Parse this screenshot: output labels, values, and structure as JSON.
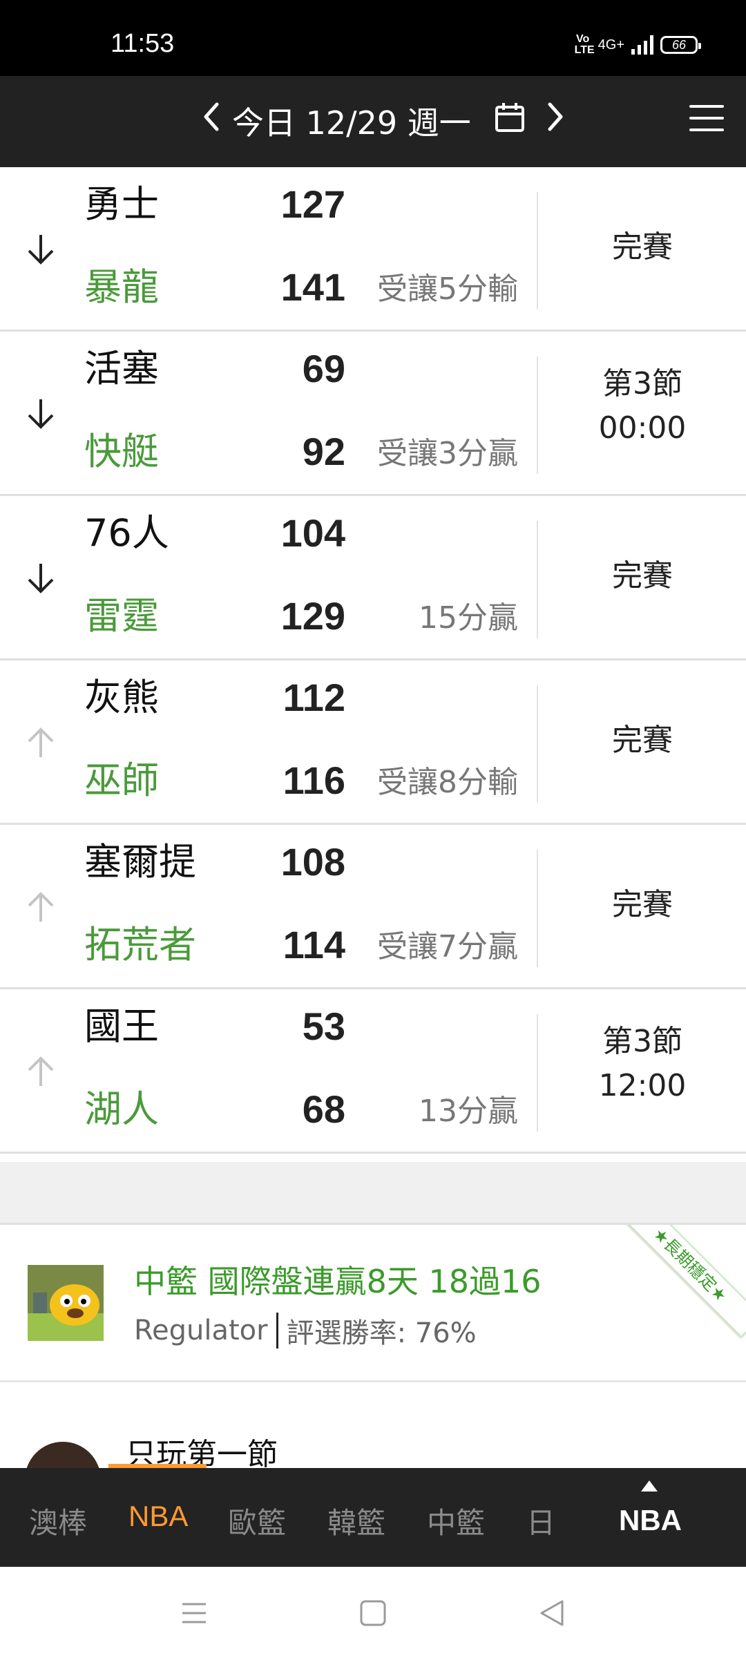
{
  "status_bar": {
    "time": "11:53",
    "network": "4G+",
    "volte": "Vo LTE",
    "battery": "66"
  },
  "header": {
    "date_label": "今日 12/29 週一",
    "prev_icon": "chevron-left-icon",
    "next_icon": "chevron-right-icon",
    "calendar_icon": "calendar-icon",
    "menu_icon": "hamburger-menu-icon"
  },
  "games": [
    {
      "away_team": "勇士",
      "away_score": "127",
      "home_team": "暴龍",
      "home_score": "141",
      "result": "受讓5分輸",
      "status_line1": "完賽",
      "status_line2": "",
      "arrow": "down",
      "arrow_color": "#222222"
    },
    {
      "away_team": "活塞",
      "away_score": "69",
      "home_team": "快艇",
      "home_score": "92",
      "result": "受讓3分贏",
      "status_line1": "第3節",
      "status_line2": "00:00",
      "arrow": "down",
      "arrow_color": "#222222"
    },
    {
      "away_team": "76人",
      "away_score": "104",
      "home_team": "雷霆",
      "home_score": "129",
      "result": "15分贏",
      "status_line1": "完賽",
      "status_line2": "",
      "arrow": "down",
      "arrow_color": "#222222"
    },
    {
      "away_team": "灰熊",
      "away_score": "112",
      "home_team": "巫師",
      "home_score": "116",
      "result": "受讓8分輸",
      "status_line1": "完賽",
      "status_line2": "",
      "arrow": "up",
      "arrow_color": "#c4c4c4"
    },
    {
      "away_team": "塞爾提",
      "away_score": "108",
      "home_team": "拓荒者",
      "home_score": "114",
      "result": "受讓7分贏",
      "status_line1": "完賽",
      "status_line2": "",
      "arrow": "up",
      "arrow_color": "#c4c4c4"
    },
    {
      "away_team": "國王",
      "away_score": "53",
      "home_team": "湖人",
      "home_score": "68",
      "result": "13分贏",
      "status_line1": "第3節",
      "status_line2": "12:00",
      "arrow": "up",
      "arrow_color": "#c4c4c4"
    }
  ],
  "promo": {
    "title": "中籃 國際盤連贏8天 18過16",
    "username": "Regulator",
    "win_rate": "評選勝率: 76%",
    "ribbon": "★長期穩定★",
    "accent": "#3a9b2a"
  },
  "card2": {
    "title": "只玩第一節"
  },
  "tabs": [
    {
      "label": "澳棒",
      "active": false
    },
    {
      "label": "NBA",
      "active": true
    },
    {
      "label": "歐籃",
      "active": false
    },
    {
      "label": "韓籃",
      "active": false
    },
    {
      "label": "中籃",
      "active": false
    },
    {
      "label": "日",
      "active": false
    }
  ],
  "tab_main": "NBA",
  "accent_orange": "#ff9a30"
}
